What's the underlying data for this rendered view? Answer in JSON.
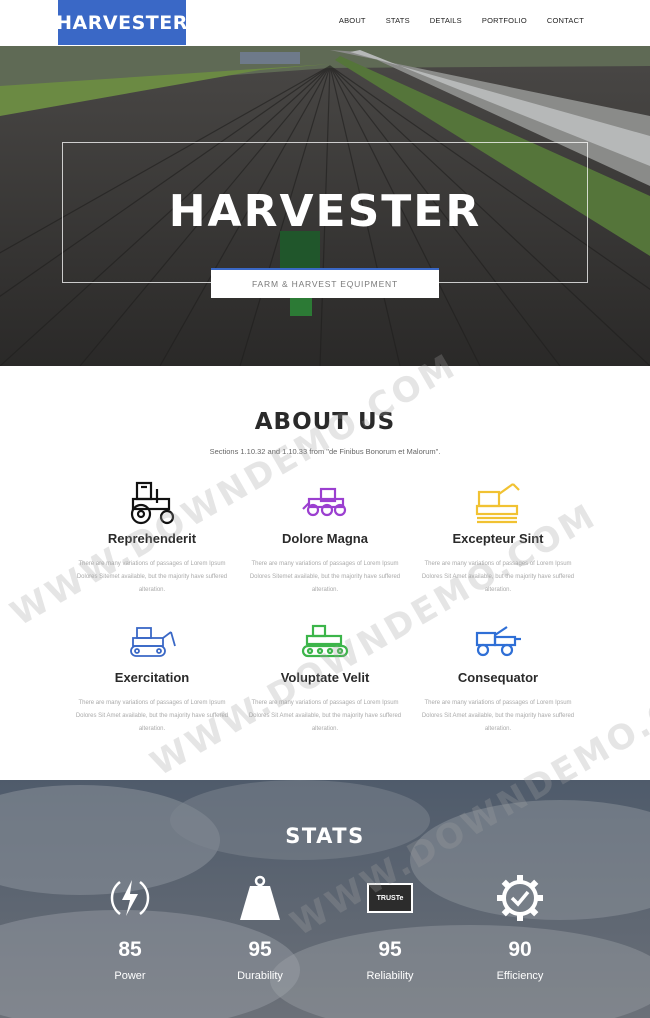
{
  "header": {
    "logo": "HARVESTER",
    "nav": [
      "ABOUT",
      "STATS",
      "DETAILS",
      "PORTFOLIO",
      "CONTACT"
    ]
  },
  "hero": {
    "title": "HARVESTER",
    "subtitle": "FARM & HARVEST EQUIPMENT"
  },
  "about": {
    "title": "ABOUT US",
    "subtitle": "Sections 1.10.32 and 1.10.33 from \"de Finibus Bonorum et Malorum\".",
    "features": [
      {
        "title": "Reprehenderit",
        "text": "There are many variations of passages of Lorem Ipsum Dolores Sitemet available, but the majority have suffered alteration.",
        "icon": "tractor-icon",
        "color": "#111111"
      },
      {
        "title": "Dolore Magna",
        "text": "There are many variations of passages of Lorem Ipsum Dolores Sitemet available, but the majority have suffered alteration.",
        "icon": "tractor-icon",
        "color": "#9b3fd0"
      },
      {
        "title": "Excepteur Sint",
        "text": "There are many variations of passages of Lorem Ipsum Dolores Sit Amet available, but the majority have suffered alteration.",
        "icon": "harvester-icon",
        "color": "#f1c232"
      },
      {
        "title": "Exercitation",
        "text": "There are many variations of passages of Lorem Ipsum Dolores Sit Amet available, but the majority have suffered alteration.",
        "icon": "bulldozer-icon",
        "color": "#3a68c6"
      },
      {
        "title": "Voluptate Velit",
        "text": "There are many variations of passages of Lorem Ipsum Dolores Sit Amet available, but the majority have suffered alteration.",
        "icon": "crawler-tractor-icon",
        "color": "#3cb54a"
      },
      {
        "title": "Consequator",
        "text": "There are many variations of passages of Lorem Ipsum Dolores Sit Amet available, but the majority have suffered alteration.",
        "icon": "combine-icon",
        "color": "#2f6fd6"
      }
    ]
  },
  "stats": {
    "title": "STATS",
    "items": [
      {
        "value": "85",
        "label": "Power",
        "icon": "lightning-icon"
      },
      {
        "value": "95",
        "label": "Durability",
        "icon": "weight-icon"
      },
      {
        "value": "95",
        "label": "Reliability",
        "icon": "truste-badge-icon",
        "badge": "TRUSTe"
      },
      {
        "value": "90",
        "label": "Efficiency",
        "icon": "gear-check-icon"
      }
    ]
  },
  "watermark": "WWW.DOWNDEMO.COM",
  "colors": {
    "accent": "#3a68c6"
  }
}
